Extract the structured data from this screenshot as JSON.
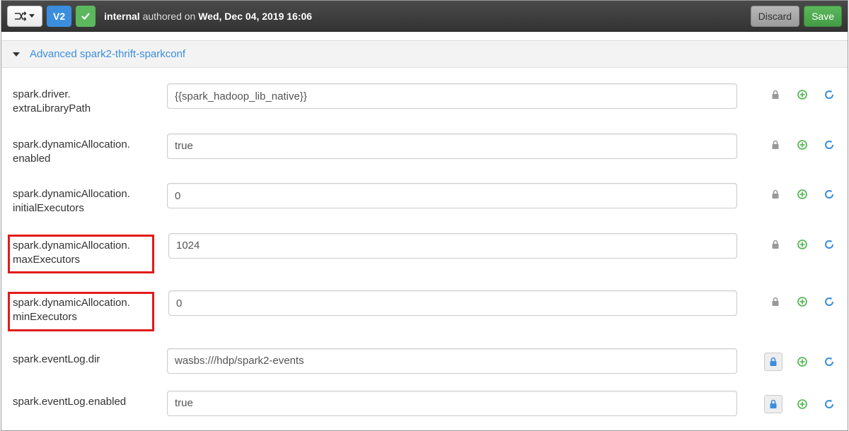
{
  "topbar": {
    "version_label": "V2",
    "author_prefix": "internal",
    "author_mid": " authored on ",
    "author_date": "Wed, Dec 04, 2019 16:06",
    "discard_label": "Discard",
    "save_label": "Save"
  },
  "section": {
    "title": "Advanced spark2-thrift-sparkconf"
  },
  "properties": [
    {
      "label": "spark.driver.\nextraLibraryPath",
      "value": "{{spark_hadoop_lib_native}}",
      "lock_active": false,
      "highlight": false
    },
    {
      "label": "spark.dynamicAllocation.\nenabled",
      "value": "true",
      "lock_active": false,
      "highlight": false
    },
    {
      "label": "spark.dynamicAllocation.\ninitialExecutors",
      "value": "0",
      "lock_active": false,
      "highlight": false
    },
    {
      "label": "spark.dynamicAllocation.\nmaxExecutors",
      "value": "1024",
      "lock_active": false,
      "highlight": true
    },
    {
      "label": "spark.dynamicAllocation.\nminExecutors",
      "value": "0",
      "lock_active": false,
      "highlight": true
    },
    {
      "label": "spark.eventLog.dir",
      "value": "wasbs:///hdp/spark2-events",
      "lock_active": true,
      "highlight": false
    },
    {
      "label": "spark.eventLog.enabled",
      "value": "true",
      "lock_active": true,
      "highlight": false
    }
  ]
}
